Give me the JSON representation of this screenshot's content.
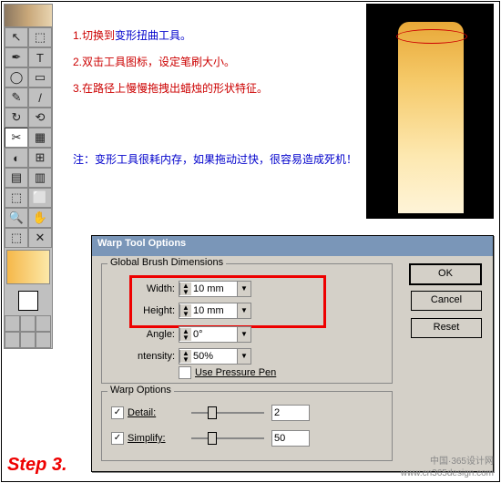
{
  "instructions": {
    "l1n": "1.",
    "l1": "切换到",
    "l1b": "变形扭曲工具。",
    "l2n": "2.",
    "l2": "双击工具图标，设定笔刷大小。",
    "l3n": "3.",
    "l3": "在路径上慢慢拖拽出蜡烛的形状特征。"
  },
  "note": {
    "pre": "注：",
    "txt": "变形工具很耗内存，如果拖动过快，很容易造成死机！"
  },
  "dialog": {
    "title": "Warp Tool Options",
    "grp1": "Global Brush Dimensions",
    "grp2": "Warp Options",
    "width_lbl": "Width:",
    "width_val": "10 mm",
    "height_lbl": "Height:",
    "height_val": "10 mm",
    "angle_lbl": "Angle:",
    "angle_val": "0°",
    "intensity_lbl": "ntensity:",
    "intensity_val": "50%",
    "pressure": "Use Pressure Pen",
    "detail": "Detail:",
    "detail_val": "2",
    "simplify": "Simplify:",
    "simplify_val": "50",
    "ok": "OK",
    "cancel": "Cancel",
    "reset": "Reset"
  },
  "step": "Step 3.",
  "credit1": "中国·365设计网",
  "credit2": "www.cn365design.com",
  "tools": [
    "↖",
    "⬚",
    "✒",
    "T",
    "◯",
    "▭",
    "✎",
    "/",
    "↻",
    "⟲",
    "✂",
    "▦",
    "◐",
    "⊞",
    "▤",
    "▥",
    "⬚",
    "⬜",
    "🔍",
    "✋",
    "⬚",
    "⬚",
    "⬚",
    "✕"
  ]
}
